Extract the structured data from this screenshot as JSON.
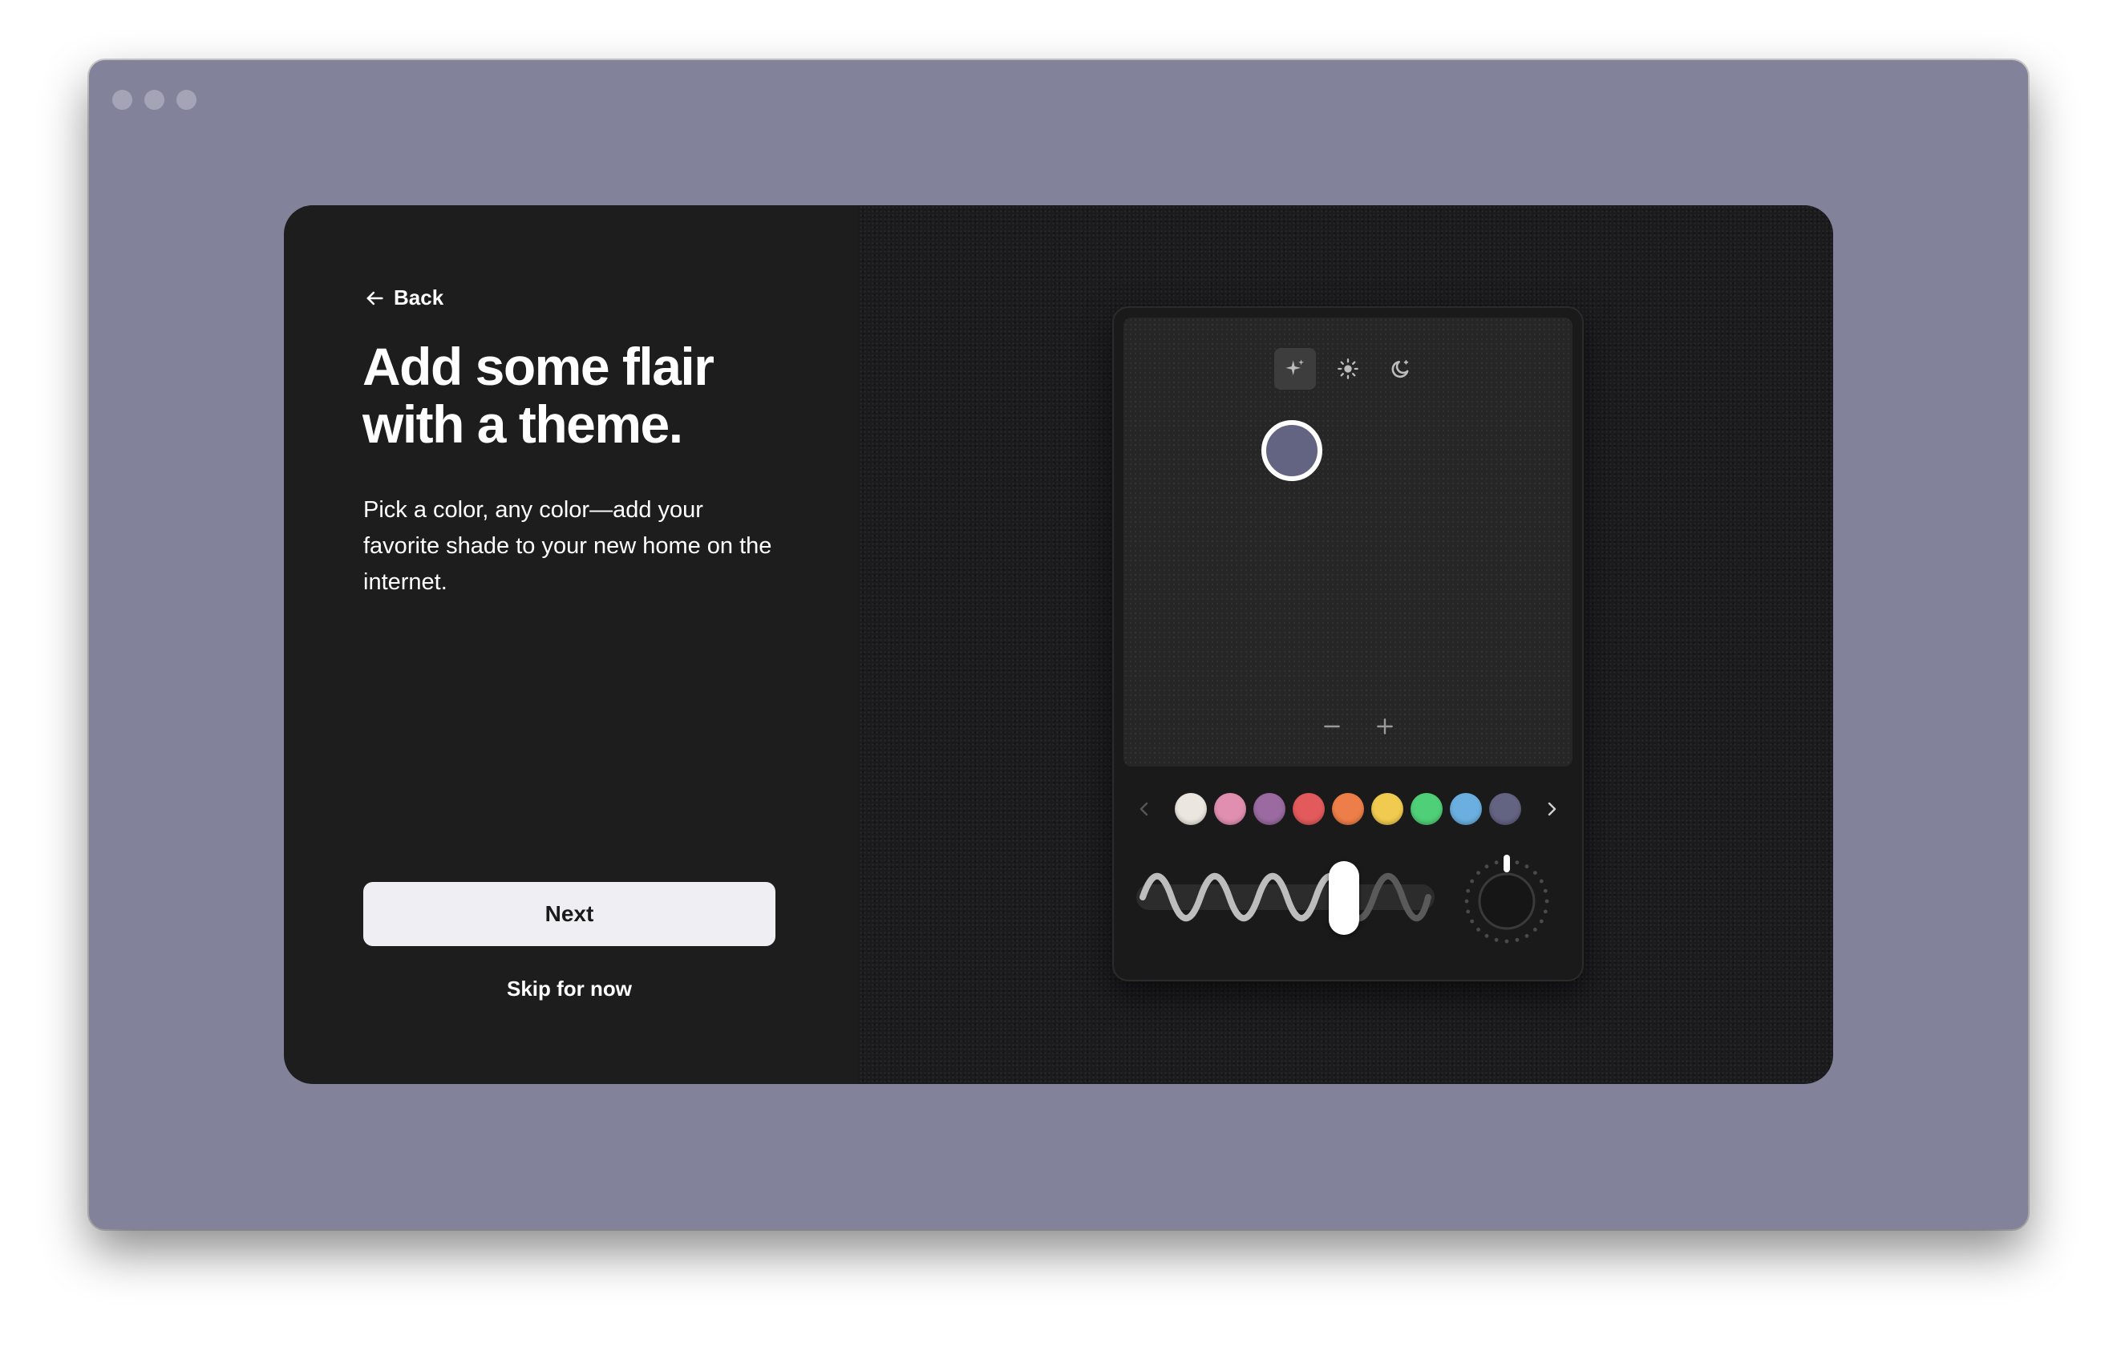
{
  "nav": {
    "back_label": "Back"
  },
  "onboarding": {
    "title": "Add some flair with a theme.",
    "description": "Pick a color, any color—add your favorite shade to your new home on the internet.",
    "next_label": "Next",
    "skip_label": "Skip for now"
  },
  "theme_picker": {
    "modes": [
      {
        "name": "sparkle",
        "icon": "sparkle-icon",
        "active": true
      },
      {
        "name": "light",
        "icon": "sun-icon",
        "active": false
      },
      {
        "name": "dark",
        "icon": "moon-icon",
        "active": false
      }
    ],
    "selected_color": "#636382",
    "swatches": [
      {
        "color": "#ebe6df"
      },
      {
        "color": "#e18fb0"
      },
      {
        "color": "#9a6aa0"
      },
      {
        "color": "#e35a5c"
      },
      {
        "color": "#ee7e49"
      },
      {
        "color": "#f1cb4f"
      },
      {
        "color": "#4fcf78"
      },
      {
        "color": "#6aafe0"
      },
      {
        "color": "#636382"
      }
    ],
    "wave_level": 0.72,
    "knob_level": 0.0
  },
  "window": {
    "background": "#82829a"
  }
}
